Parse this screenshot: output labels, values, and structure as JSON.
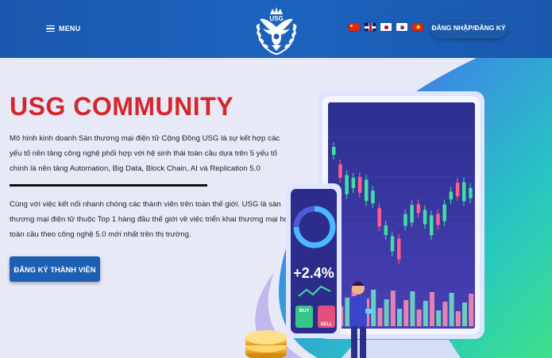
{
  "header": {
    "menu_label": "MENU",
    "logo_text": "USG",
    "flags": [
      "flag-cn",
      "flag-gb",
      "flag-jp",
      "flag-kr",
      "flag-vn"
    ],
    "login_label": "ĐĂNG NHẬP/ĐĂNG KÝ"
  },
  "hero": {
    "title": "USG COMMUNITY",
    "paragraph1": "Mô hình kinh doanh Sàn thương mại điện tử Cộng Đồng USG là sự kết hợp các yếu tố nền tảng công nghệ phối hợp với hệ sinh thái toàn cầu dựa trên 5 yếu tố chính là nền tảng Automation, Big Data, Block Chain, AI và Replication 5.0",
    "paragraph2": "Cùng với việc kết nối nhanh chóng các thành viên trên toàn thế giới. USG là sàn thương mại điện tử thuộc Top 1 hàng đầu thế giới về việc triển khai thương mại hóa toàn cầu theo công nghệ 5.0 mới nhất trên thị trường.",
    "cta_label": "ĐĂNG KÝ THÀNH VIÊN"
  },
  "illustration": {
    "percent": "+2.4%",
    "buy_label": "BUY",
    "sell_label": "SELL"
  },
  "colors": {
    "header_blue": "#1b5bb0",
    "title_red": "#d4262b",
    "cta_blue": "#1d5fb2",
    "hero_bg": "#e8e9f7"
  }
}
